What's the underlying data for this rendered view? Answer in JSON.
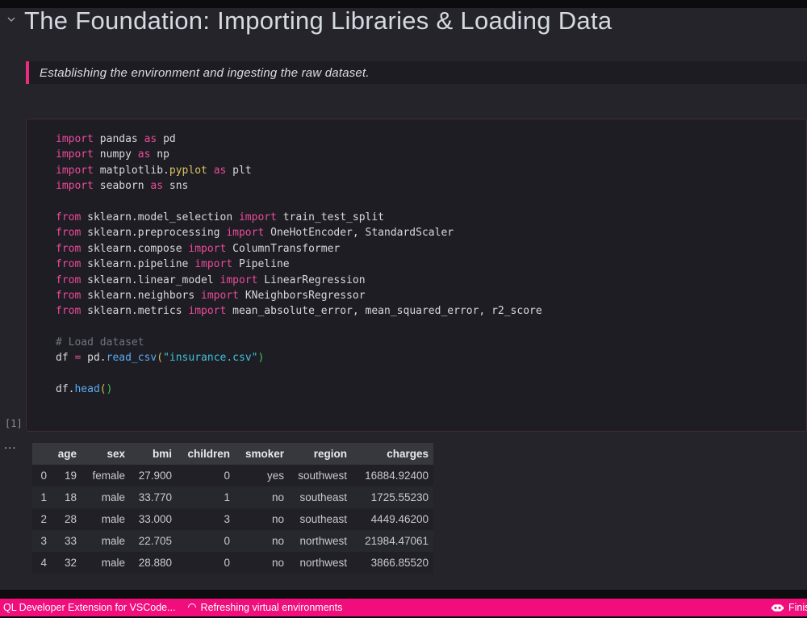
{
  "header": {
    "title": "The Foundation: Importing Libraries & Loading Data"
  },
  "quote": {
    "text": "Establishing the environment and ingesting the raw dataset.",
    "accent_color": "#ee2b7f"
  },
  "code_cell": {
    "execution_count": "[1]",
    "language": "python",
    "lines": [
      [
        {
          "t": "import",
          "c": "kw"
        },
        {
          "t": " pandas ",
          "c": "pl"
        },
        {
          "t": "as",
          "c": "kw"
        },
        {
          "t": " pd",
          "c": "pl"
        }
      ],
      [
        {
          "t": "import",
          "c": "kw"
        },
        {
          "t": " numpy ",
          "c": "pl"
        },
        {
          "t": "as",
          "c": "kw"
        },
        {
          "t": " np",
          "c": "pl"
        }
      ],
      [
        {
          "t": "import",
          "c": "kw"
        },
        {
          "t": " matplotlib.",
          "c": "pl"
        },
        {
          "t": "pyplot",
          "c": "yl"
        },
        {
          "t": " ",
          "c": "pl"
        },
        {
          "t": "as",
          "c": "kw"
        },
        {
          "t": " plt",
          "c": "pl"
        }
      ],
      [
        {
          "t": "import",
          "c": "kw"
        },
        {
          "t": " seaborn ",
          "c": "pl"
        },
        {
          "t": "as",
          "c": "kw"
        },
        {
          "t": " sns",
          "c": "pl"
        }
      ],
      [],
      [
        {
          "t": "from",
          "c": "kw"
        },
        {
          "t": " sklearn.model_selection ",
          "c": "pl"
        },
        {
          "t": "import",
          "c": "kw"
        },
        {
          "t": " train_test_split",
          "c": "pl"
        }
      ],
      [
        {
          "t": "from",
          "c": "kw"
        },
        {
          "t": " sklearn.preprocessing ",
          "c": "pl"
        },
        {
          "t": "import",
          "c": "kw"
        },
        {
          "t": " OneHotEncoder, StandardScaler",
          "c": "pl"
        }
      ],
      [
        {
          "t": "from",
          "c": "kw"
        },
        {
          "t": " sklearn.compose ",
          "c": "pl"
        },
        {
          "t": "import",
          "c": "kw"
        },
        {
          "t": " ColumnTransformer",
          "c": "pl"
        }
      ],
      [
        {
          "t": "from",
          "c": "kw"
        },
        {
          "t": " sklearn.pipeline ",
          "c": "pl"
        },
        {
          "t": "import",
          "c": "kw"
        },
        {
          "t": " Pipeline",
          "c": "pl"
        }
      ],
      [
        {
          "t": "from",
          "c": "kw"
        },
        {
          "t": " sklearn.linear_model ",
          "c": "pl"
        },
        {
          "t": "import",
          "c": "kw"
        },
        {
          "t": " LinearRegression",
          "c": "pl"
        }
      ],
      [
        {
          "t": "from",
          "c": "kw"
        },
        {
          "t": " sklearn.neighbors ",
          "c": "pl"
        },
        {
          "t": "import",
          "c": "kw"
        },
        {
          "t": " KNeighborsRegressor",
          "c": "pl"
        }
      ],
      [
        {
          "t": "from",
          "c": "kw"
        },
        {
          "t": " sklearn.metrics ",
          "c": "pl"
        },
        {
          "t": "import",
          "c": "kw"
        },
        {
          "t": " mean_absolute_error, mean_squared_error, r2_score",
          "c": "pl"
        }
      ],
      [],
      [
        {
          "t": "# Load dataset",
          "c": "cm"
        }
      ],
      [
        {
          "t": "df ",
          "c": "pl"
        },
        {
          "t": "=",
          "c": "kw"
        },
        {
          "t": " pd.",
          "c": "pl"
        },
        {
          "t": "read_csv",
          "c": "fn"
        },
        {
          "t": "(",
          "c": "py"
        },
        {
          "t": "\"insurance.csv\"",
          "c": "str"
        },
        {
          "t": ")",
          "c": "pg"
        }
      ],
      [],
      [
        {
          "t": "df.",
          "c": "pl"
        },
        {
          "t": "head",
          "c": "fn"
        },
        {
          "t": "(",
          "c": "py"
        },
        {
          "t": ")",
          "c": "pg"
        }
      ]
    ]
  },
  "output": {
    "more_actions_label": "...",
    "table": {
      "columns": [
        "",
        "age",
        "sex",
        "bmi",
        "children",
        "smoker",
        "region",
        "charges"
      ],
      "rows": [
        [
          "0",
          "19",
          "female",
          "27.900",
          "0",
          "yes",
          "southwest",
          "16884.92400"
        ],
        [
          "1",
          "18",
          "male",
          "33.770",
          "1",
          "no",
          "southeast",
          "1725.55230"
        ],
        [
          "2",
          "28",
          "male",
          "33.000",
          "3",
          "no",
          "southeast",
          "4449.46200"
        ],
        [
          "3",
          "33",
          "male",
          "22.705",
          "0",
          "no",
          "northwest",
          "21984.47061"
        ],
        [
          "4",
          "32",
          "male",
          "28.880",
          "0",
          "no",
          "northwest",
          "3866.85520"
        ]
      ]
    }
  },
  "status_bar": {
    "background_color": "#f10e7c",
    "left_item": "QL Developer Extension for VSCode...",
    "refresh_item": "Refreshing virtual environments",
    "right_item": "Finis"
  }
}
